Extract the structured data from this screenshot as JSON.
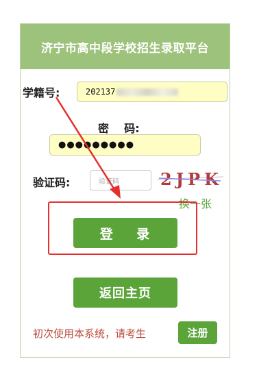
{
  "header": {
    "title": "济宁市高中段学校招生录取平台"
  },
  "form": {
    "student_id_label": "学籍号:",
    "student_id_value": "202137",
    "password_label": "密    码:",
    "password_value": "●●●●●●●●●",
    "captcha_label": "验证码:",
    "captcha_placeholder": "验证码",
    "captcha_text": "2JPK",
    "captcha_refresh": "换一张"
  },
  "buttons": {
    "login": "登 录",
    "home": "返回主页",
    "register": "注册"
  },
  "notice": "初次使用本系统，请考生",
  "colors": {
    "header_bg": "#9cc27b",
    "button_bg": "#5aa43a",
    "field_bg": "#fdfdc4",
    "highlight": "#e3302f",
    "notice": "#b94a3a"
  }
}
